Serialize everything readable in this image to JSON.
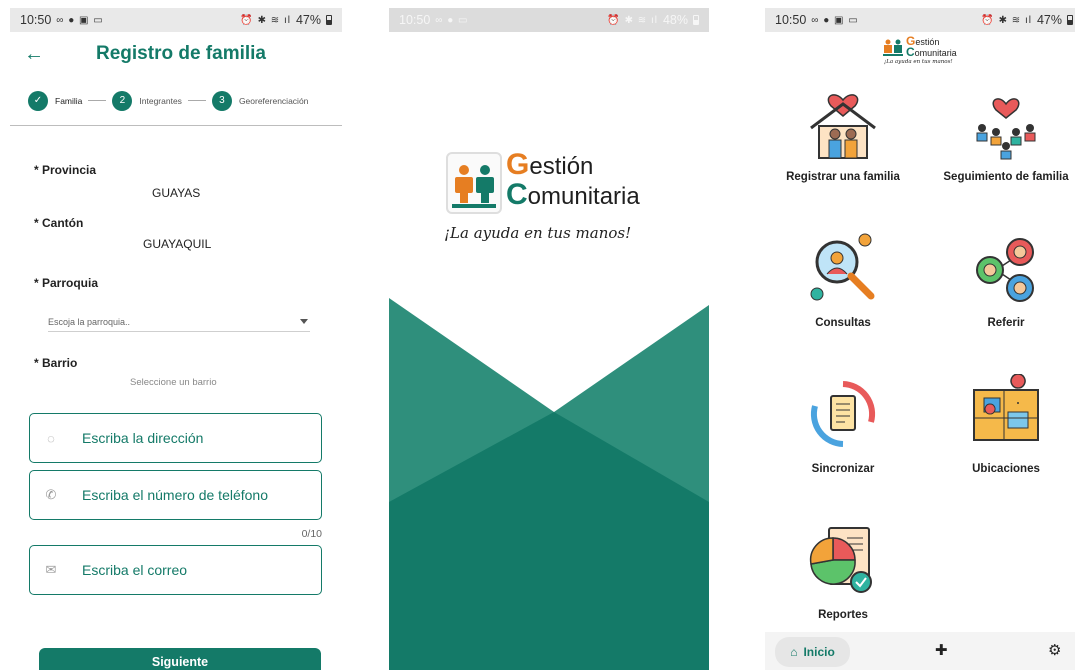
{
  "status1": {
    "time": "10:50",
    "battery": "47%"
  },
  "status2": {
    "time": "10:50",
    "battery": "48%"
  },
  "status3": {
    "time": "10:50",
    "battery": "47%"
  },
  "form": {
    "title": "Registro de familia",
    "steps": [
      {
        "number": "✓",
        "label": "Familia"
      },
      {
        "number": "2",
        "label": "Integrantes"
      },
      {
        "number": "3",
        "label": "Georeferenciación"
      }
    ],
    "provincia_label": "* Provincia",
    "provincia_value": "GUAYAS",
    "canton_label": "* Cantón",
    "canton_value": "GUAYAQUIL",
    "parroquia_label": "* Parroquia",
    "parroquia_placeholder": "Escoja la parroquia..",
    "barrio_label": "* Barrio",
    "barrio_placeholder": "Seleccione un barrio",
    "direccion_placeholder": "Escriba la dirección",
    "telefono_placeholder": "Escriba el número de teléfono",
    "telefono_counter": "0/10",
    "correo_placeholder": "Escriba el correo",
    "next_button": "Siguiente"
  },
  "brand": {
    "g_letter": "G",
    "word1": "estión",
    "c_letter": "C",
    "word2": "omunitaria",
    "tagline": "¡La ayuda en tus manos!"
  },
  "menu": {
    "items": [
      {
        "label": "Registrar una familia",
        "icon": "house-heart-family-icon"
      },
      {
        "label": "Seguimiento de familia",
        "icon": "family-tracking-icon"
      },
      {
        "label": "Consultas",
        "icon": "magnifier-person-icon"
      },
      {
        "label": "Referir",
        "icon": "referral-people-icon"
      },
      {
        "label": "Sincronizar",
        "icon": "sync-document-icon"
      },
      {
        "label": "Ubicaciones",
        "icon": "map-pin-icon"
      },
      {
        "label": "Reportes",
        "icon": "report-piechart-icon"
      }
    ],
    "nav_home": "Inicio"
  },
  "colors": {
    "primary": "#147a68",
    "accent_orange": "#e67e22"
  }
}
